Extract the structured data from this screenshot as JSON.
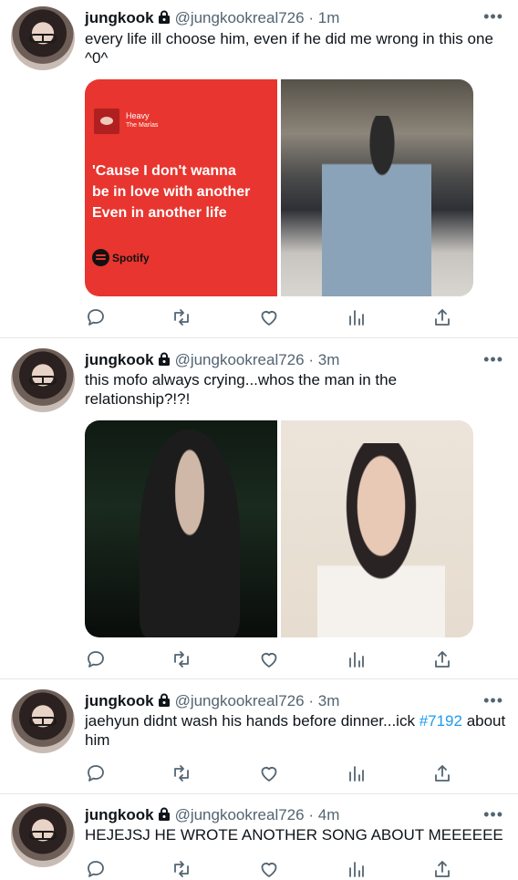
{
  "tweets": [
    {
      "name": "jungkook",
      "handle": "@jungkookreal726",
      "sep": "·",
      "time": "1m",
      "text": "every life ill choose him, even if he did me wrong in this one ^0^",
      "media": {
        "spotify": {
          "song": "Heavy",
          "artist": "The Marías",
          "lyric": "'Cause I don't wanna\nbe in love with another\nEven in another life",
          "brand": "Spotify"
        }
      }
    },
    {
      "name": "jungkook",
      "handle": "@jungkookreal726",
      "sep": "·",
      "time": "3m",
      "text": "this mofo always crying...whos the man in the relationship?!?!"
    },
    {
      "name": "jungkook",
      "handle": "@jungkookreal726",
      "sep": "·",
      "time": "3m",
      "text_before": "jaehyun didnt wash his hands before dinner...ick ",
      "hashtag": "#7192",
      "text_after": " about him"
    },
    {
      "name": "jungkook",
      "handle": "@jungkookreal726",
      "sep": "·",
      "time": "4m",
      "text": "HEJEJSJ HE WROTE ANOTHER SONG ABOUT MEEEEEE"
    }
  ],
  "more_glyph": "•••",
  "icons": [
    "reply-icon",
    "retweet-icon",
    "like-icon",
    "views-icon",
    "share-icon",
    "lock-icon",
    "more-icon"
  ]
}
